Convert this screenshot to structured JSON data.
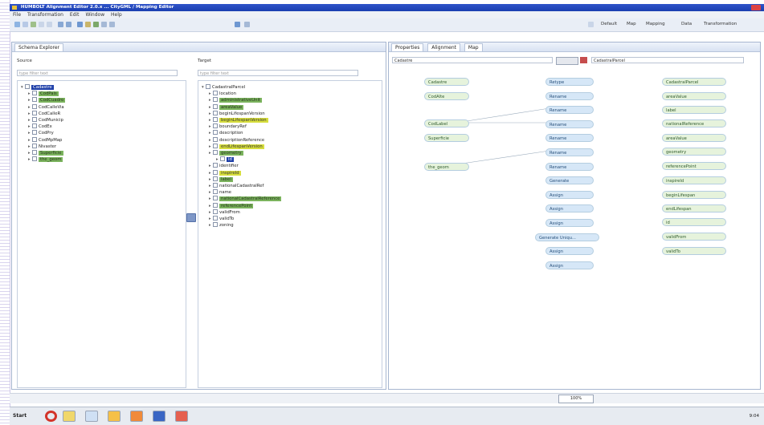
{
  "window": {
    "title": "HUMBOLT Alignment Editor 2.0.x   ...  CityGML / Mapping Editor"
  },
  "menu": [
    "File",
    "Transformation",
    "Edit",
    "Window",
    "Help"
  ],
  "toolbar": {
    "right_items": [
      "Default",
      "Map",
      "Mapping",
      "Data",
      "Transformation"
    ]
  },
  "schema_explorer": {
    "tab": "Schema Explorer",
    "source_label": "Source",
    "target_label": "Target",
    "filter_placeholder": "type filter text",
    "source_tree": [
      {
        "label": "Cadastre",
        "level": 0,
        "hl": "b"
      },
      {
        "label": "CodPais",
        "level": 1,
        "hl": "g"
      },
      {
        "label": "CodCuadro",
        "level": 1,
        "hl": "g"
      },
      {
        "label": "CodCalleVia",
        "level": 1,
        "hl": ""
      },
      {
        "label": "CodCalleR",
        "level": 1,
        "hl": ""
      },
      {
        "label": "CodMunicip",
        "level": 1,
        "hl": ""
      },
      {
        "label": "CodEx",
        "level": 1,
        "hl": ""
      },
      {
        "label": "CodPry",
        "level": 1,
        "hl": ""
      },
      {
        "label": "CodMpMap",
        "level": 1,
        "hl": ""
      },
      {
        "label": "Nivaster",
        "level": 1,
        "hl": ""
      },
      {
        "label": "Superficie",
        "level": 1,
        "hl": "g"
      },
      {
        "label": "the_geom",
        "level": 1,
        "hl": "g"
      }
    ],
    "target_tree": [
      {
        "label": "CadastralParcel",
        "level": 0,
        "hl": ""
      },
      {
        "label": "location",
        "level": 1,
        "hl": ""
      },
      {
        "label": "administrativeUnit",
        "level": 1,
        "hl": "g"
      },
      {
        "label": "areaValue",
        "level": 1,
        "hl": "g"
      },
      {
        "label": "beginLifespanVersion",
        "level": 1,
        "hl": ""
      },
      {
        "label": "beginLifespanVersion",
        "level": 1,
        "hl": "y"
      },
      {
        "label": "boundaryRef",
        "level": 1,
        "hl": ""
      },
      {
        "label": "description",
        "level": 1,
        "hl": ""
      },
      {
        "label": "descriptionReference",
        "level": 1,
        "hl": ""
      },
      {
        "label": "endLifespanVersion",
        "level": 1,
        "hl": "y"
      },
      {
        "label": "geometry",
        "level": 1,
        "hl": "g"
      },
      {
        "label": "id",
        "level": 2,
        "hl": "b"
      },
      {
        "label": "identifier",
        "level": 1,
        "hl": ""
      },
      {
        "label": "inspireId",
        "level": 1,
        "hl": "y"
      },
      {
        "label": "label",
        "level": 1,
        "hl": "g"
      },
      {
        "label": "nationalCadastralRef",
        "level": 1,
        "hl": ""
      },
      {
        "label": "name",
        "level": 1,
        "hl": ""
      },
      {
        "label": "nationalCadastralReference",
        "level": 1,
        "hl": "g"
      },
      {
        "label": "referencePoint",
        "level": 1,
        "hl": "g"
      },
      {
        "label": "validFrom",
        "level": 1,
        "hl": ""
      },
      {
        "label": "validTo",
        "level": 1,
        "hl": ""
      },
      {
        "label": "zoning",
        "level": 1,
        "hl": ""
      }
    ]
  },
  "alignment": {
    "tabs": [
      "Properties",
      "Alignment",
      "Map"
    ],
    "source_type": "Cadastre",
    "target_type": "CadastralParcel",
    "source_nodes": [
      "Cadastre",
      "CodAlte",
      "CodLabel",
      "Superficie",
      "the_geom"
    ],
    "op_nodes": [
      "Retype",
      "Rename",
      "Rename",
      "Rename",
      "Rename",
      "Rename",
      "Rename",
      "Generate",
      "Assign",
      "Assign",
      "Assign",
      "Generate Uniqu...",
      "Assign",
      "Assign"
    ],
    "target_nodes": [
      "CadastralParcel",
      "areaValue",
      "label",
      "nationalReference",
      "areaValue",
      "geometry",
      "referencePoint",
      "inspireId",
      "beginLifespan",
      "endLifespan",
      "id",
      "validFrom",
      "validTo"
    ]
  },
  "statusbar": {
    "zoom": "100%"
  },
  "taskbar": {
    "start": "Start",
    "clock": "9:04"
  },
  "colors": {
    "titlebar": "#1b3fb0",
    "green": "#7bb35d",
    "yellow": "#d7de3d",
    "blue": "#1e3fa8"
  }
}
